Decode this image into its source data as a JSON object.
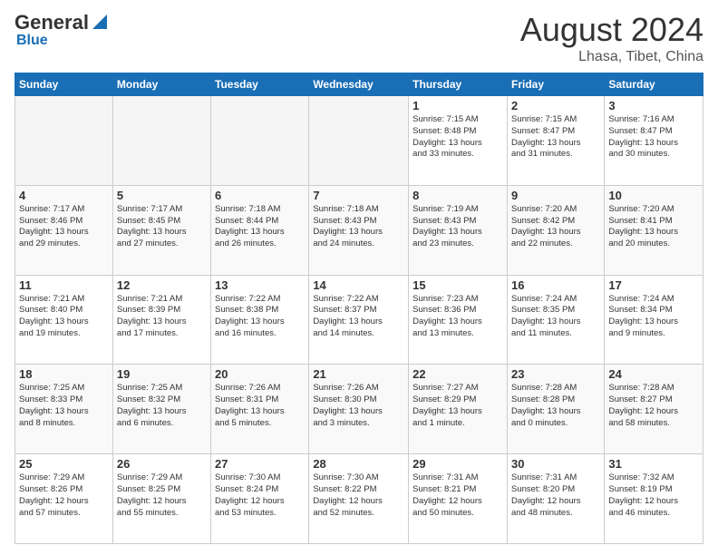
{
  "header": {
    "logo_line1": "General",
    "logo_line2": "Blue",
    "month_year": "August 2024",
    "location": "Lhasa, Tibet, China"
  },
  "days_of_week": [
    "Sunday",
    "Monday",
    "Tuesday",
    "Wednesday",
    "Thursday",
    "Friday",
    "Saturday"
  ],
  "weeks": [
    [
      {
        "day": "",
        "info": ""
      },
      {
        "day": "",
        "info": ""
      },
      {
        "day": "",
        "info": ""
      },
      {
        "day": "",
        "info": ""
      },
      {
        "day": "1",
        "info": "Sunrise: 7:15 AM\nSunset: 8:48 PM\nDaylight: 13 hours\nand 33 minutes."
      },
      {
        "day": "2",
        "info": "Sunrise: 7:15 AM\nSunset: 8:47 PM\nDaylight: 13 hours\nand 31 minutes."
      },
      {
        "day": "3",
        "info": "Sunrise: 7:16 AM\nSunset: 8:47 PM\nDaylight: 13 hours\nand 30 minutes."
      }
    ],
    [
      {
        "day": "4",
        "info": "Sunrise: 7:17 AM\nSunset: 8:46 PM\nDaylight: 13 hours\nand 29 minutes."
      },
      {
        "day": "5",
        "info": "Sunrise: 7:17 AM\nSunset: 8:45 PM\nDaylight: 13 hours\nand 27 minutes."
      },
      {
        "day": "6",
        "info": "Sunrise: 7:18 AM\nSunset: 8:44 PM\nDaylight: 13 hours\nand 26 minutes."
      },
      {
        "day": "7",
        "info": "Sunrise: 7:18 AM\nSunset: 8:43 PM\nDaylight: 13 hours\nand 24 minutes."
      },
      {
        "day": "8",
        "info": "Sunrise: 7:19 AM\nSunset: 8:43 PM\nDaylight: 13 hours\nand 23 minutes."
      },
      {
        "day": "9",
        "info": "Sunrise: 7:20 AM\nSunset: 8:42 PM\nDaylight: 13 hours\nand 22 minutes."
      },
      {
        "day": "10",
        "info": "Sunrise: 7:20 AM\nSunset: 8:41 PM\nDaylight: 13 hours\nand 20 minutes."
      }
    ],
    [
      {
        "day": "11",
        "info": "Sunrise: 7:21 AM\nSunset: 8:40 PM\nDaylight: 13 hours\nand 19 minutes."
      },
      {
        "day": "12",
        "info": "Sunrise: 7:21 AM\nSunset: 8:39 PM\nDaylight: 13 hours\nand 17 minutes."
      },
      {
        "day": "13",
        "info": "Sunrise: 7:22 AM\nSunset: 8:38 PM\nDaylight: 13 hours\nand 16 minutes."
      },
      {
        "day": "14",
        "info": "Sunrise: 7:22 AM\nSunset: 8:37 PM\nDaylight: 13 hours\nand 14 minutes."
      },
      {
        "day": "15",
        "info": "Sunrise: 7:23 AM\nSunset: 8:36 PM\nDaylight: 13 hours\nand 13 minutes."
      },
      {
        "day": "16",
        "info": "Sunrise: 7:24 AM\nSunset: 8:35 PM\nDaylight: 13 hours\nand 11 minutes."
      },
      {
        "day": "17",
        "info": "Sunrise: 7:24 AM\nSunset: 8:34 PM\nDaylight: 13 hours\nand 9 minutes."
      }
    ],
    [
      {
        "day": "18",
        "info": "Sunrise: 7:25 AM\nSunset: 8:33 PM\nDaylight: 13 hours\nand 8 minutes."
      },
      {
        "day": "19",
        "info": "Sunrise: 7:25 AM\nSunset: 8:32 PM\nDaylight: 13 hours\nand 6 minutes."
      },
      {
        "day": "20",
        "info": "Sunrise: 7:26 AM\nSunset: 8:31 PM\nDaylight: 13 hours\nand 5 minutes."
      },
      {
        "day": "21",
        "info": "Sunrise: 7:26 AM\nSunset: 8:30 PM\nDaylight: 13 hours\nand 3 minutes."
      },
      {
        "day": "22",
        "info": "Sunrise: 7:27 AM\nSunset: 8:29 PM\nDaylight: 13 hours\nand 1 minute."
      },
      {
        "day": "23",
        "info": "Sunrise: 7:28 AM\nSunset: 8:28 PM\nDaylight: 13 hours\nand 0 minutes."
      },
      {
        "day": "24",
        "info": "Sunrise: 7:28 AM\nSunset: 8:27 PM\nDaylight: 12 hours\nand 58 minutes."
      }
    ],
    [
      {
        "day": "25",
        "info": "Sunrise: 7:29 AM\nSunset: 8:26 PM\nDaylight: 12 hours\nand 57 minutes."
      },
      {
        "day": "26",
        "info": "Sunrise: 7:29 AM\nSunset: 8:25 PM\nDaylight: 12 hours\nand 55 minutes."
      },
      {
        "day": "27",
        "info": "Sunrise: 7:30 AM\nSunset: 8:24 PM\nDaylight: 12 hours\nand 53 minutes."
      },
      {
        "day": "28",
        "info": "Sunrise: 7:30 AM\nSunset: 8:22 PM\nDaylight: 12 hours\nand 52 minutes."
      },
      {
        "day": "29",
        "info": "Sunrise: 7:31 AM\nSunset: 8:21 PM\nDaylight: 12 hours\nand 50 minutes."
      },
      {
        "day": "30",
        "info": "Sunrise: 7:31 AM\nSunset: 8:20 PM\nDaylight: 12 hours\nand 48 minutes."
      },
      {
        "day": "31",
        "info": "Sunrise: 7:32 AM\nSunset: 8:19 PM\nDaylight: 12 hours\nand 46 minutes."
      }
    ]
  ]
}
